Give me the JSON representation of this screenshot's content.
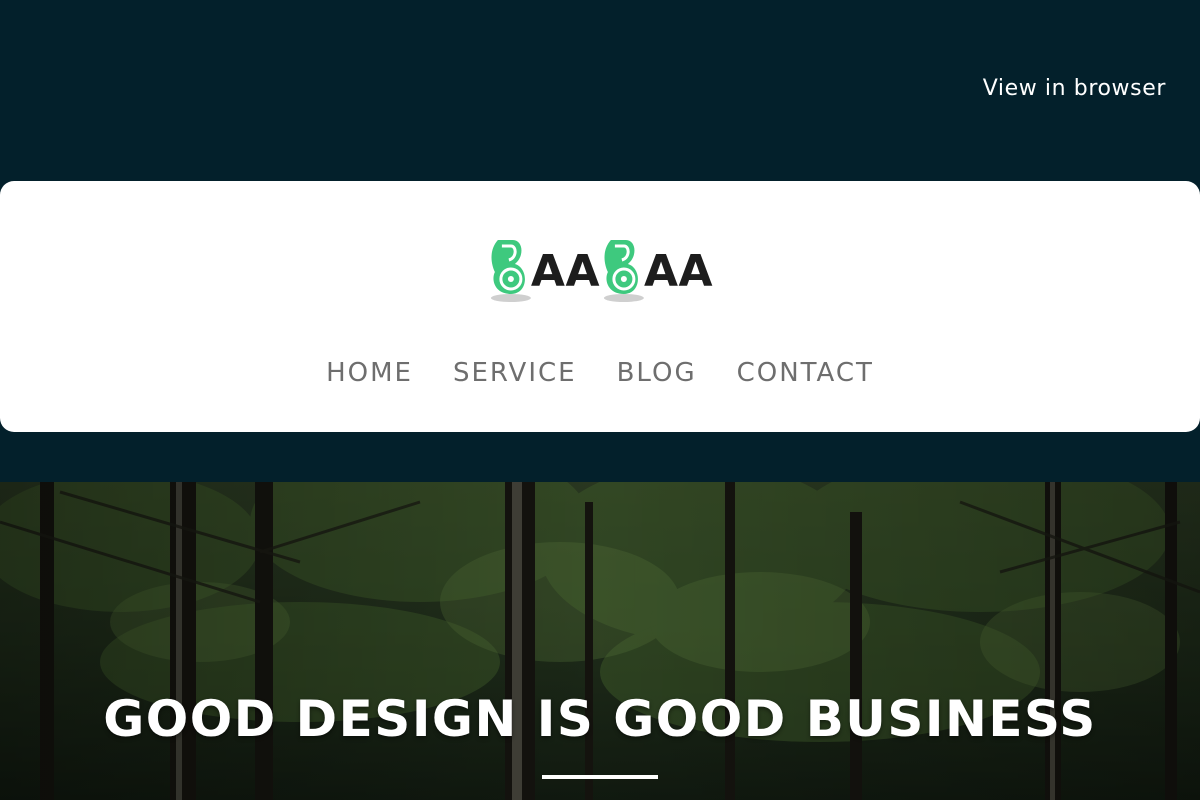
{
  "topbar": {
    "view_in_browser": "View in browser"
  },
  "brand": {
    "logo_text_1": "AA",
    "logo_text_2": "AA",
    "accent_color": "#3ec97e"
  },
  "nav": {
    "items": [
      {
        "label": "HOME"
      },
      {
        "label": "SERVICE"
      },
      {
        "label": "BLOG"
      },
      {
        "label": "CONTACT"
      }
    ]
  },
  "hero": {
    "title": "GOOD DESIGN IS GOOD BUSINESS"
  },
  "colors": {
    "background": "#03202b",
    "card": "#ffffff",
    "nav_text": "#6e6e6e"
  }
}
